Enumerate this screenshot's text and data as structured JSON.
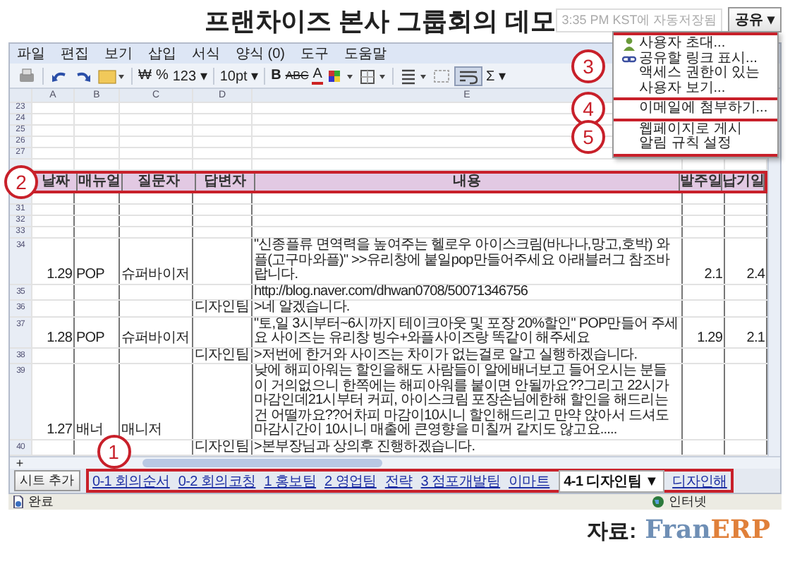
{
  "title": "프랜차이즈 본사 그룹회의 데모",
  "autosave": "3:35 PM KST에 자동저장됨",
  "share_button": "공유 ▾",
  "share_menu": [
    {
      "annotation": "3",
      "items": [
        {
          "label": "사용자 초대...",
          "kind": "invite"
        },
        {
          "label": "공유할 링크 표시...",
          "kind": "link"
        },
        {
          "label": "액세스 권한이 있는 사용자 보기...",
          "kind": "plain"
        }
      ]
    },
    {
      "annotation": "4",
      "items": [
        {
          "label": "이메일에 첨부하기...",
          "kind": "plain"
        }
      ]
    },
    {
      "annotation": "5",
      "items": [
        {
          "label": "웹페이지로 게시",
          "kind": "plain"
        },
        {
          "label": "알림 규칙 설정",
          "kind": "plain"
        }
      ]
    }
  ],
  "menu": [
    "파일",
    "편집",
    "보기",
    "삽입",
    "서식",
    "양식 (0)",
    "도구",
    "도움말"
  ],
  "toolbar": [
    {
      "kind": "print",
      "pressed": false
    },
    {
      "kind": "separator"
    },
    {
      "kind": "undo",
      "pressed": false
    },
    {
      "kind": "redo",
      "pressed": false
    },
    {
      "kind": "folder",
      "pressed": false
    },
    {
      "kind": "separator"
    },
    {
      "kind": "text",
      "text": "₩",
      "pressed": false
    },
    {
      "kind": "text",
      "text": "%",
      "pressed": false
    },
    {
      "kind": "text",
      "text": "123 ▾",
      "pressed": false
    },
    {
      "kind": "separator"
    },
    {
      "kind": "text",
      "text": "10pt ▾",
      "pressed": false
    },
    {
      "kind": "separator"
    },
    {
      "kind": "bold",
      "text": "B",
      "pressed": false
    },
    {
      "kind": "strike",
      "text": "ABC",
      "pressed": false
    },
    {
      "kind": "text-color",
      "text": "A",
      "pressed": false
    },
    {
      "kind": "fill-color",
      "pressed": false
    },
    {
      "kind": "borders",
      "pressed": false
    },
    {
      "kind": "separator"
    },
    {
      "kind": "align",
      "pressed": false
    },
    {
      "kind": "merge",
      "pressed": false
    },
    {
      "kind": "wrap",
      "pressed": true
    },
    {
      "kind": "text",
      "text": "Σ ▾",
      "pressed": false
    }
  ],
  "column_letters": [
    "A",
    "B",
    "C",
    "D",
    "E"
  ],
  "rows": [
    {
      "kind": "empty",
      "number": "23"
    },
    {
      "kind": "empty",
      "number": "24"
    },
    {
      "kind": "empty",
      "number": "25"
    },
    {
      "kind": "empty",
      "number": "26"
    },
    {
      "kind": "empty",
      "number": "27"
    },
    {
      "kind": "empty"
    },
    {
      "kind": "header",
      "annotation": "2",
      "cells": {
        "date": "날짜",
        "manual": "매뉴얼",
        "asker": "질문자",
        "answerer": "답변자",
        "content": "내용",
        "order_date": "발주일",
        "due_date": "납기일"
      }
    },
    {
      "kind": "empty"
    },
    {
      "kind": "empty",
      "number": "31"
    },
    {
      "kind": "empty",
      "number": "32"
    },
    {
      "kind": "empty",
      "number": "33"
    },
    {
      "kind": "data",
      "number": "34",
      "cells": {
        "date": "1.29",
        "manual": "POP",
        "asker": "슈퍼바이저",
        "content": "\"신종플류 면역력을 높여주는 헬로우 아이스크림(바나나,망고,호박) 와플(고구마와플)\" >>유리창에 붙일pop만들어주세요 아래블러그 참조바랍니다.",
        "order_date": "2.1",
        "due_date": "2.4"
      }
    },
    {
      "kind": "data",
      "number": "35",
      "cells": {
        "content": "http://blog.naver.com/dhwan0708/50071346756"
      }
    },
    {
      "kind": "data",
      "number": "36",
      "cells": {
        "answerer": "디자인팀",
        "content": ">네 알겠습니다."
      }
    },
    {
      "kind": "data",
      "number": "37",
      "cells": {
        "date": "1.28",
        "manual": "POP",
        "asker": "슈퍼바이저",
        "content": "\"토,일 3시부터~6시까지 테이크아웃 및 포장 20%할인\" POP만들어 주세요 사이즈는 유리창 빙수+와플사이즈랑 똑같이 해주세요",
        "order_date": "1.29",
        "due_date": "2.1"
      }
    },
    {
      "kind": "data",
      "number": "38",
      "cells": {
        "answerer": "디자인팀",
        "content": ">저번에 한거와 사이즈는 차이가 없는걸로 알고 실행하겠습니다."
      }
    },
    {
      "kind": "data",
      "number": "39",
      "cells": {
        "date": "1.27",
        "manual": "배너",
        "asker": "매니저",
        "content": "낮에 해피아워는 할인을해도 사람들이 알에배너보고 들어오시는 분들이 거의없으니 한쪽에는 해피아워를 붙이면 안될까요??그리고 22시가 마감인데21시부터 커피, 아이스크림 포장손님에한해 할인을 해드리는건 어떨까요??어차피 마감이10시니 할인해드리고 만약 앉아서 드셔도 마감시간이 10시니 매출에 큰영향을 미칠꺼 같지도 않고요....."
      }
    },
    {
      "kind": "data",
      "number": "40",
      "cells": {
        "answerer": "디자인팀",
        "content": ">본부장님과 상의후 진행하겠습니다."
      }
    }
  ],
  "add_row": "+",
  "sheet_add": "시트 추가",
  "sheet_tabs": {
    "annotation": "1",
    "tabs": [
      {
        "label": "0-1 회의순서",
        "selected": false
      },
      {
        "label": "0-2 회의코칭",
        "selected": false
      },
      {
        "label": "1 홍보팀",
        "selected": false
      },
      {
        "label": "2 영업팀",
        "selected": false
      },
      {
        "label": "전략",
        "selected": false
      },
      {
        "label": "3 점포개발팀",
        "selected": false
      },
      {
        "label": "이마트",
        "selected": false
      },
      {
        "label": "4-1 디자인팀 ▼",
        "selected": true
      },
      {
        "label": "디자인해",
        "selected": false
      }
    ]
  },
  "status": {
    "text": "완료",
    "zone": "인터넷"
  },
  "source": {
    "label": "자료:",
    "logo_a": "Fran",
    "logo_b": "ERP"
  }
}
